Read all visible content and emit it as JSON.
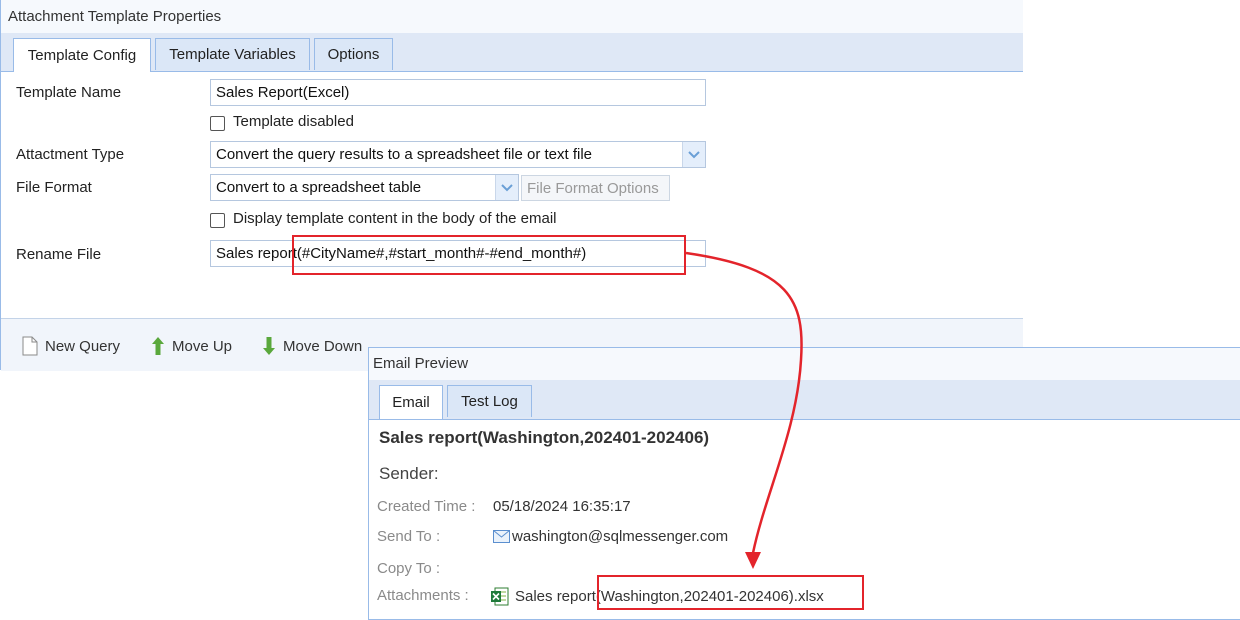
{
  "panel1": {
    "title": "Attachment Template Properties",
    "tabs": [
      "Template Config",
      "Template Variables",
      "Options"
    ],
    "active_tab": "Template Config",
    "fields": {
      "template_name_label": "Template Name",
      "template_name_value": "Sales Report(Excel)",
      "template_disabled_label": "Template disabled",
      "attachment_type_label": "Attactment Type",
      "attachment_type_value": "Convert the query results to a spreadsheet file or text file",
      "file_format_label": "File Format",
      "file_format_value": "Convert to a spreadsheet table",
      "file_format_options_button": "File Format Options",
      "display_content_label": "Display template content in the body of the email",
      "rename_file_label": "Rename File",
      "rename_file_value": "Sales report(#CityName#,#start_month#-#end_month#)"
    },
    "toolbar": {
      "new_query": "New Query",
      "move_up": "Move Up",
      "move_down": "Move Down"
    }
  },
  "panel2": {
    "title": "Email Preview",
    "tabs": [
      "Email",
      "Test Log"
    ],
    "active_tab": "Email",
    "subject": "Sales report(Washington,202401-202406)",
    "sender_label": "Sender:",
    "created_time_label": "Created Time :",
    "created_time_value": "05/18/2024 16:35:17",
    "send_to_label": "Send To :",
    "send_to_value": "washington@sqlmessenger.com",
    "copy_to_label": "Copy To :",
    "attachments_label": "Attachments :",
    "attachment_value": "Sales report(Washington,202401-202406).xlsx"
  },
  "colors": {
    "panel_border": "#99bbe8",
    "tab_strip": "#dfe8f6",
    "highlight": "#e3242b"
  },
  "icons": [
    "new-query-icon",
    "move-up-icon",
    "move-down-icon",
    "mail-icon",
    "excel-file-icon",
    "combo-arrow-icon"
  ]
}
